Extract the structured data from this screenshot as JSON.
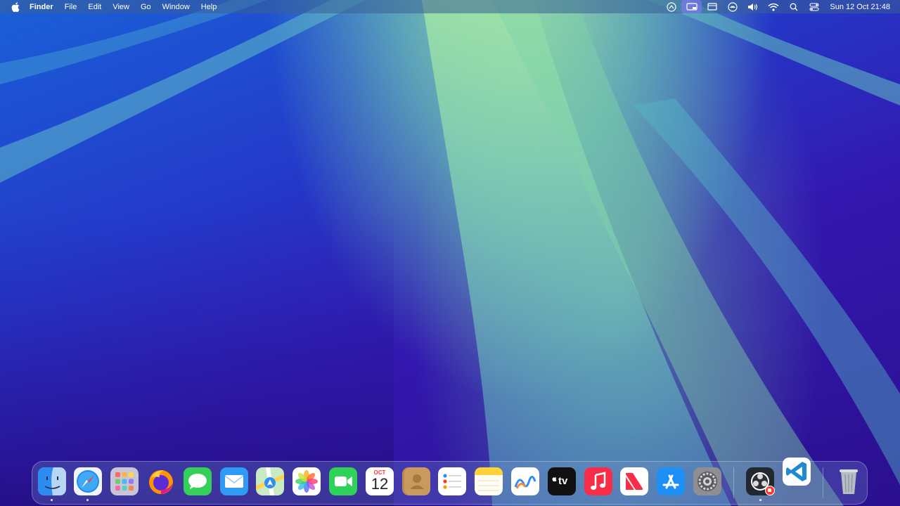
{
  "menubar": {
    "app_name": "Finder",
    "menus": [
      "File",
      "Edit",
      "View",
      "Go",
      "Window",
      "Help"
    ],
    "clock": "Sun 12 Oct  21:48",
    "status_icons": [
      "screen-mirror-icon",
      "stage-manager-icon",
      "display-icon",
      "vpn-icon",
      "volume-icon",
      "wifi-icon",
      "search-icon",
      "control-center-icon"
    ]
  },
  "dock": {
    "apps": [
      {
        "name": "Finder",
        "icon": "finder-icon",
        "running": true
      },
      {
        "name": "Safari",
        "icon": "safari-icon",
        "running": true
      },
      {
        "name": "Launchpad",
        "icon": "launchpad-icon",
        "running": false
      },
      {
        "name": "Firefox",
        "icon": "firefox-icon",
        "running": false
      },
      {
        "name": "Messages",
        "icon": "messages-icon",
        "running": false
      },
      {
        "name": "Mail",
        "icon": "mail-icon",
        "running": false
      },
      {
        "name": "Maps",
        "icon": "maps-icon",
        "running": false
      },
      {
        "name": "Photos",
        "icon": "photos-icon",
        "running": false
      },
      {
        "name": "FaceTime",
        "icon": "facetime-icon",
        "running": false
      },
      {
        "name": "Calendar",
        "icon": "calendar-icon",
        "running": false
      },
      {
        "name": "Contacts",
        "icon": "contacts-icon",
        "running": false
      },
      {
        "name": "Reminders",
        "icon": "reminders-icon",
        "running": false
      },
      {
        "name": "Notes",
        "icon": "notes-icon",
        "running": false
      },
      {
        "name": "Freeform",
        "icon": "freeform-icon",
        "running": false
      },
      {
        "name": "TV",
        "icon": "tv-icon",
        "running": false
      },
      {
        "name": "Music",
        "icon": "music-icon",
        "running": false
      },
      {
        "name": "News",
        "icon": "news-icon",
        "running": false
      },
      {
        "name": "App Store",
        "icon": "app-store-icon",
        "running": false
      },
      {
        "name": "System Settings",
        "icon": "settings-icon",
        "running": false
      },
      {
        "name": "OBS",
        "icon": "obs-icon",
        "running": true
      },
      {
        "name": "Visual Studio Code",
        "icon": "vscode-icon",
        "running": false
      },
      {
        "name": "Trash",
        "icon": "trash-icon",
        "running": false
      }
    ],
    "calendar_month": "OCT",
    "calendar_day": "12",
    "tv_label": "tv"
  },
  "colors": {
    "wallpaper_light": "#aee6a0",
    "wallpaper_dark": "#2a0f8e",
    "recording_badge": "#ff3b30"
  }
}
